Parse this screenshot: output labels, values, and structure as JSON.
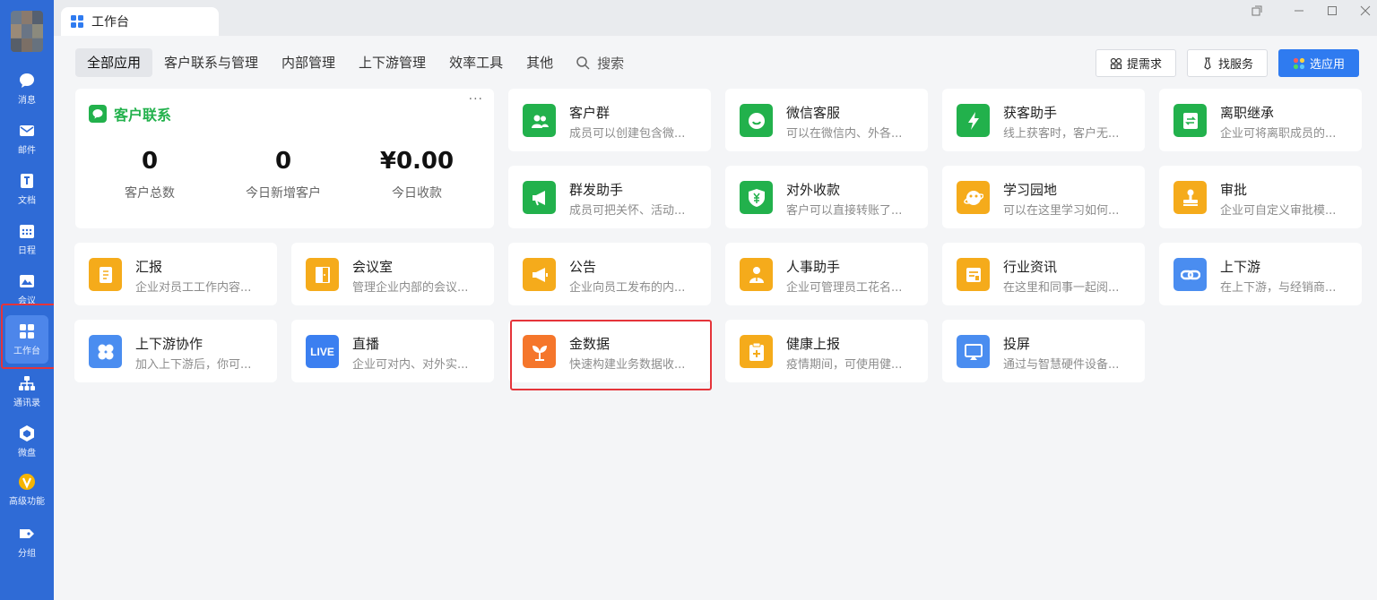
{
  "window": {
    "tab_title": "工作台"
  },
  "sidebar": {
    "items": [
      {
        "id": "messages",
        "label": "消息",
        "icon": "chat-icon"
      },
      {
        "id": "mail",
        "label": "邮件",
        "icon": "mail-icon"
      },
      {
        "id": "docs",
        "label": "文档",
        "icon": "doc-icon"
      },
      {
        "id": "calendar",
        "label": "日程",
        "icon": "calendar-icon"
      },
      {
        "id": "meeting",
        "label": "会议",
        "icon": "meeting-icon"
      },
      {
        "id": "workbench",
        "label": "工作台",
        "icon": "grid-icon"
      },
      {
        "id": "contacts",
        "label": "通讯录",
        "icon": "org-icon"
      },
      {
        "id": "drive",
        "label": "微盘",
        "icon": "drive-icon"
      },
      {
        "id": "advanced",
        "label": "高级功能",
        "icon": "advanced-icon"
      },
      {
        "id": "groups",
        "label": "分组",
        "icon": "tag-icon"
      }
    ]
  },
  "categories": [
    "全部应用",
    "客户联系与管理",
    "内部管理",
    "上下游管理",
    "效率工具",
    "其他"
  ],
  "search": {
    "label": "搜索"
  },
  "actions": {
    "request": "提需求",
    "service": "找服务",
    "choose": "选应用"
  },
  "customer": {
    "title": "客户联系",
    "more": "···",
    "stats": [
      {
        "value": "0",
        "label": "客户总数"
      },
      {
        "value": "0",
        "label": "今日新增客户"
      },
      {
        "value": "¥0.00",
        "label": "今日收款"
      }
    ]
  },
  "apps": [
    {
      "name": "客户群",
      "desc": "成员可以创建包含微...",
      "color": "#22b14c",
      "icon": "group-icon"
    },
    {
      "name": "微信客服",
      "desc": "可以在微信内、外各...",
      "color": "#22b14c",
      "icon": "wechat-service-icon"
    },
    {
      "name": "获客助手",
      "desc": "线上获客时，客户无...",
      "color": "#22b14c",
      "icon": "lightning-icon"
    },
    {
      "name": "离职继承",
      "desc": "企业可将离职成员的...",
      "color": "#22b14c",
      "icon": "transfer-icon"
    },
    {
      "name": "群发助手",
      "desc": "成员可把关怀、活动...",
      "color": "#22b14c",
      "icon": "megaphone-icon"
    },
    {
      "name": "对外收款",
      "desc": "客户可以直接转账了...",
      "color": "#22b14c",
      "icon": "yuan-shield-icon"
    },
    {
      "name": "学习园地",
      "desc": "可以在这里学习如何...",
      "color": "#f5ab1b",
      "icon": "planet-icon"
    },
    {
      "name": "审批",
      "desc": "企业可自定义审批模...",
      "color": "#f5ab1b",
      "icon": "stamp-icon"
    },
    {
      "name": "汇报",
      "desc": "企业对员工工作内容...",
      "color": "#f5ab1b",
      "icon": "report-icon"
    },
    {
      "name": "会议室",
      "desc": "管理企业内部的会议...",
      "color": "#f5ab1b",
      "icon": "door-icon"
    },
    {
      "name": "公告",
      "desc": "企业向员工发布的内...",
      "color": "#f5ab1b",
      "icon": "announce-icon"
    },
    {
      "name": "人事助手",
      "desc": "企业可管理员工花名...",
      "color": "#f5ab1b",
      "icon": "person-icon"
    },
    {
      "name": "行业资讯",
      "desc": "在这里和同事一起阅...",
      "color": "#f5ab1b",
      "icon": "news-icon"
    },
    {
      "name": "上下游",
      "desc": "在上下游，与经销商...",
      "color": "#4a8df0",
      "icon": "link-icon"
    },
    {
      "name": "上下游协作",
      "desc": "加入上下游后，你可...",
      "color": "#4a8df0",
      "icon": "clover-icon"
    },
    {
      "name": "直播",
      "desc": "企业可对内、对外实...",
      "color": "#3b7ff0",
      "icon": "live-icon",
      "badge": "LIVE"
    },
    {
      "name": "金数据",
      "desc": "快速构建业务数据收...",
      "color": "#f5762b",
      "icon": "sprout-icon"
    },
    {
      "name": "健康上报",
      "desc": "疫情期间，可使用健...",
      "color": "#f5ab1b",
      "icon": "clipboard-plus-icon"
    },
    {
      "name": "投屏",
      "desc": "通过与智慧硬件设备...",
      "color": "#4a8df0",
      "icon": "cast-icon"
    }
  ]
}
